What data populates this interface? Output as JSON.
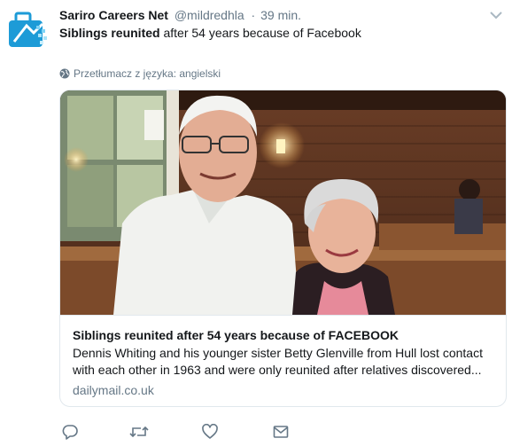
{
  "tweet": {
    "author_name": "Sariro Careers Net",
    "author_handle": "@mildredhla",
    "separator": "·",
    "timestamp": "39 min.",
    "text_bold": "Siblings reunited",
    "text_rest": " after 54 years because of Facebook",
    "translate_label": "Przetłumacz z języka: angielski"
  },
  "card": {
    "title": "Siblings reunited after 54 years because of FACEBOOK",
    "description": "Dennis Whiting and his younger sister Betty Glenville from Hull lost contact with each other in 1963 and were only reunited after relatives discovered...",
    "domain": "dailymail.co.uk"
  },
  "icons": {
    "avatar": "briefcase-logo-icon",
    "caret": "chevron-down-icon",
    "translate": "globe-icon",
    "reply": "reply-icon",
    "retweet": "retweet-icon",
    "like": "heart-icon",
    "dm": "envelope-icon"
  },
  "colors": {
    "text_primary": "#14171a",
    "text_secondary": "#657786",
    "border": "#e1e8ed",
    "avatar_blue": "#1da1f2"
  }
}
